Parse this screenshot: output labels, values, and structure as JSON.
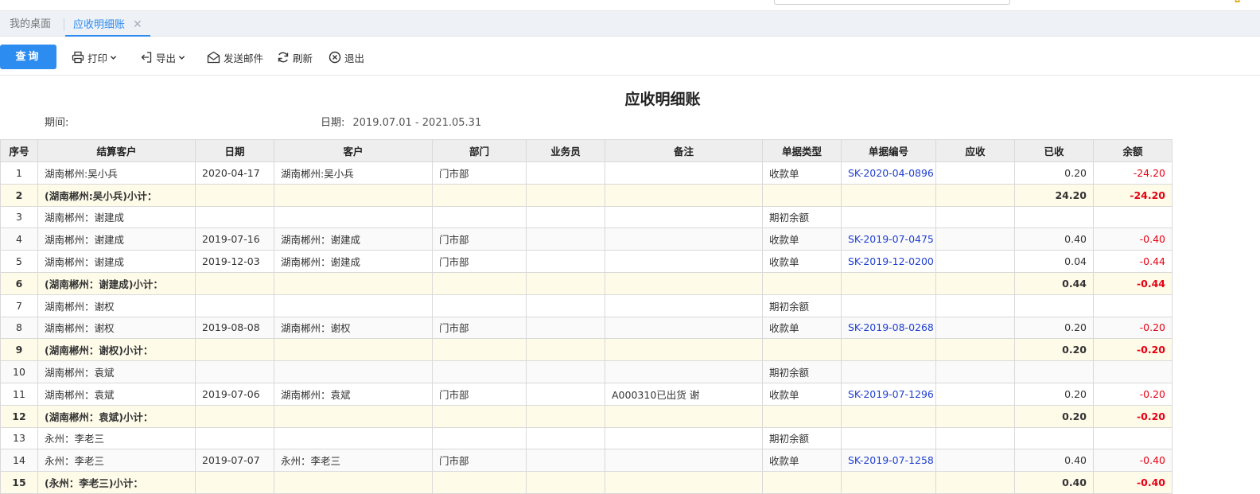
{
  "tabs": {
    "home": "我的桌面",
    "active": "应收明细账",
    "close": "✕"
  },
  "toolbar": {
    "query": "查询",
    "print": "打印",
    "export": "导出",
    "email": "发送邮件",
    "refresh": "刷新",
    "exit": "退出"
  },
  "report": {
    "title": "应收明细账",
    "period_label": "期间:",
    "period_value": "",
    "date_label": "日期:",
    "date_value": "2019.07.01 - 2021.05.31"
  },
  "table": {
    "headers": [
      "序号",
      "结算客户",
      "日期",
      "客户",
      "部门",
      "业务员",
      "备注",
      "单据类型",
      "单据编号",
      "应收",
      "已收",
      "余额"
    ],
    "rows": [
      {
        "type": "normal",
        "cells": [
          "1",
          "湖南郴州:吴小兵",
          "2020-04-17",
          "湖南郴州:吴小兵",
          "门市部",
          "",
          "",
          "收款单",
          "SK-2020-04-0896",
          "",
          "0.20",
          "-24.20"
        ]
      },
      {
        "type": "sub",
        "cells": [
          "2",
          "(湖南郴州:吴小兵)小计：",
          "",
          "",
          "",
          "",
          "",
          "",
          "",
          "",
          "24.20",
          "-24.20"
        ]
      },
      {
        "type": "normal",
        "cells": [
          "3",
          "湖南郴州：谢建成",
          "",
          "",
          "",
          "",
          "",
          "期初余额",
          "",
          "",
          "",
          ""
        ]
      },
      {
        "type": "normal",
        "cells": [
          "4",
          "湖南郴州：谢建成",
          "2019-07-16",
          "湖南郴州：谢建成",
          "门市部",
          "",
          "",
          "收款单",
          "SK-2019-07-0475",
          "",
          "0.40",
          "-0.40"
        ]
      },
      {
        "type": "normal",
        "cells": [
          "5",
          "湖南郴州：谢建成",
          "2019-12-03",
          "湖南郴州：谢建成",
          "门市部",
          "",
          "",
          "收款单",
          "SK-2019-12-0200",
          "",
          "0.04",
          "-0.44"
        ]
      },
      {
        "type": "sub",
        "cells": [
          "6",
          "(湖南郴州：谢建成)小计：",
          "",
          "",
          "",
          "",
          "",
          "",
          "",
          "",
          "0.44",
          "-0.44"
        ]
      },
      {
        "type": "normal",
        "cells": [
          "7",
          "湖南郴州：谢权",
          "",
          "",
          "",
          "",
          "",
          "期初余额",
          "",
          "",
          "",
          ""
        ]
      },
      {
        "type": "normal",
        "cells": [
          "8",
          "湖南郴州：谢权",
          "2019-08-08",
          "湖南郴州：谢权",
          "门市部",
          "",
          "",
          "收款单",
          "SK-2019-08-0268",
          "",
          "0.20",
          "-0.20"
        ]
      },
      {
        "type": "sub",
        "cells": [
          "9",
          "(湖南郴州：谢权)小计：",
          "",
          "",
          "",
          "",
          "",
          "",
          "",
          "",
          "0.20",
          "-0.20"
        ]
      },
      {
        "type": "normal",
        "cells": [
          "10",
          "湖南郴州：袁斌",
          "",
          "",
          "",
          "",
          "",
          "期初余额",
          "",
          "",
          "",
          ""
        ]
      },
      {
        "type": "normal",
        "cells": [
          "11",
          "湖南郴州：袁斌",
          "2019-07-06",
          "湖南郴州：袁斌",
          "门市部",
          "",
          "A000310已出货 谢",
          "收款单",
          "SK-2019-07-1296",
          "",
          "0.20",
          "-0.20"
        ]
      },
      {
        "type": "sub",
        "cells": [
          "12",
          "(湖南郴州：袁斌)小计：",
          "",
          "",
          "",
          "",
          "",
          "",
          "",
          "",
          "0.20",
          "-0.20"
        ]
      },
      {
        "type": "normal",
        "cells": [
          "13",
          "永州：李老三",
          "",
          "",
          "",
          "",
          "",
          "期初余额",
          "",
          "",
          "",
          ""
        ]
      },
      {
        "type": "normal",
        "cells": [
          "14",
          "永州：李老三",
          "2019-07-07",
          "永州：李老三",
          "门市部",
          "",
          "",
          "收款单",
          "SK-2019-07-1258",
          "",
          "0.40",
          "-0.40"
        ]
      },
      {
        "type": "sub",
        "cells": [
          "15",
          "(永州：李老三)小计：",
          "",
          "",
          "",
          "",
          "",
          "",
          "",
          "",
          "0.40",
          "-0.40"
        ]
      }
    ]
  },
  "colors": {
    "accent": "#2d8cf0",
    "negative": "#e60012",
    "link": "#1f3fd1",
    "subtotal_bg": "#fefbe9"
  }
}
